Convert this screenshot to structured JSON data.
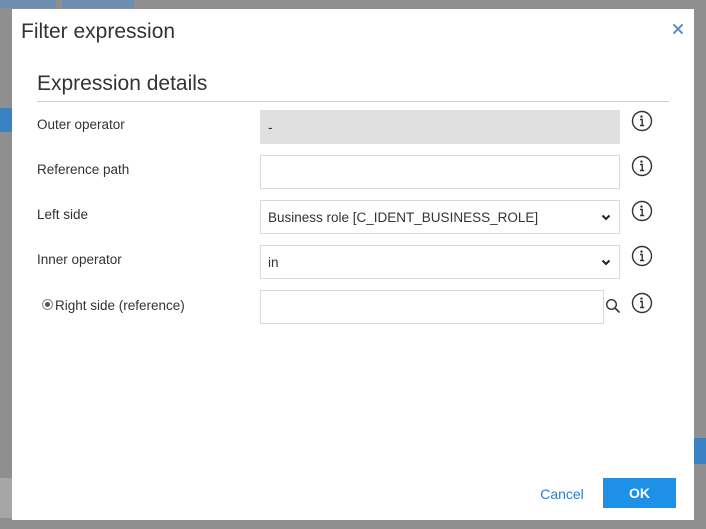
{
  "dialog": {
    "title": "Filter expression",
    "section_title": "Expression details"
  },
  "fields": {
    "outer_operator": {
      "label": "Outer operator",
      "value": "-"
    },
    "reference_path": {
      "label": "Reference path",
      "value": ""
    },
    "left_side": {
      "label": "Left side",
      "value": "Business role [C_IDENT_BUSINESS_ROLE]"
    },
    "inner_operator": {
      "label": "Inner operator",
      "value": "in"
    },
    "right_side": {
      "label": "Right side (reference)",
      "value": ""
    }
  },
  "buttons": {
    "cancel": "Cancel",
    "ok": "OK"
  },
  "icons": {
    "close": "close-icon",
    "info": "info-icon",
    "chevron": "chevron-down-icon",
    "search": "search-icon"
  },
  "colors": {
    "accent": "#1e90e8",
    "link": "#2b7cd3",
    "disabled_field": "#e0e0e0"
  }
}
